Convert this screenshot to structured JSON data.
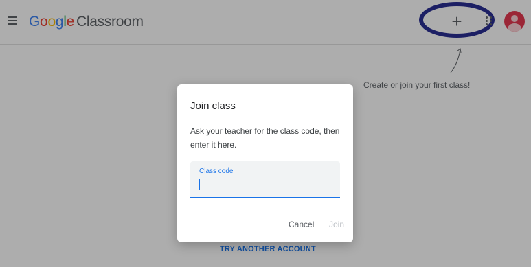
{
  "header": {
    "brand_google": [
      "G",
      "o",
      "o",
      "g",
      "l",
      "e"
    ],
    "product_name": "Classroom",
    "create_icon": "+",
    "menu_icon": "hamburger-menu-icon",
    "apps_icon": "google-apps-icon",
    "avatar_icon": "account-avatar-icon"
  },
  "hint": {
    "text": "Create or join your first class!"
  },
  "footer_link": "TRY ANOTHER ACCOUNT",
  "dialog": {
    "title": "Join class",
    "description": "Ask your teacher for the class code, then enter it here.",
    "code_field": {
      "label": "Class code",
      "value": ""
    },
    "cancel_label": "Cancel",
    "join_label": "Join"
  },
  "colors": {
    "accent": "#1a73e8",
    "annotation_circle": "#2a2f94",
    "avatar": "#e53950"
  }
}
